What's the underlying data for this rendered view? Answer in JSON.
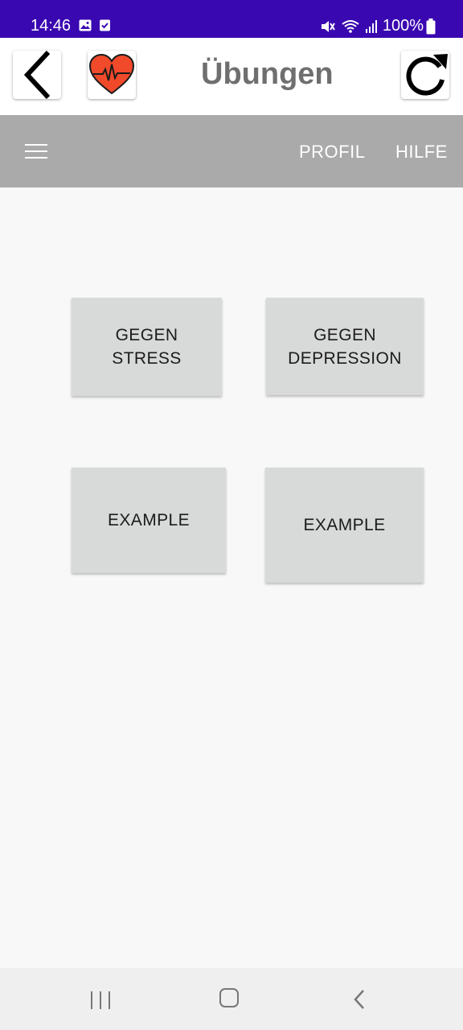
{
  "status_bar": {
    "time": "14:46",
    "battery": "100%",
    "icons": [
      "image-icon",
      "checkbox-icon",
      "mute-icon",
      "wifi-icon",
      "signal-icon",
      "battery-icon"
    ]
  },
  "header": {
    "title": "Übungen",
    "back_icon": "chevron-left-icon",
    "heart_icon": "heart-pulse-icon",
    "refresh_icon": "refresh-icon"
  },
  "toolbar": {
    "menu_icon": "hamburger-icon",
    "profil_label": "PROFIL",
    "hilfe_label": "HILFE"
  },
  "cards": [
    {
      "label": "GEGEN\nSTRESS"
    },
    {
      "label": "GEGEN\nDEPRESSION"
    },
    {
      "label": "EXAMPLE"
    },
    {
      "label": "EXAMPLE"
    }
  ],
  "nav_bar": {
    "icons": [
      "recent-apps-icon",
      "home-icon",
      "back-icon"
    ]
  },
  "colors": {
    "status_bar": "#3a08b0",
    "toolbar": "#aaaaaa",
    "card": "#d8d9d9",
    "heart": "#f04a2a"
  }
}
